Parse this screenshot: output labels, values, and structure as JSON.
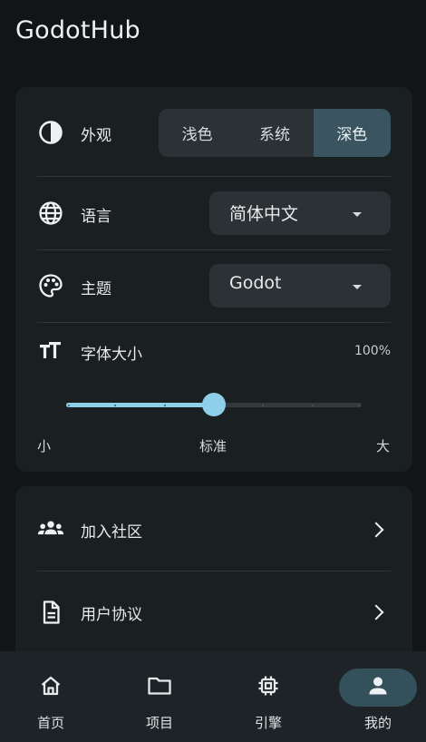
{
  "app": {
    "title": "GodotHub"
  },
  "appearance": {
    "label": "外观",
    "icon": "contrast-icon",
    "options": [
      "浅色",
      "系统",
      "深色"
    ],
    "selected_index": 2
  },
  "language": {
    "label": "语言",
    "icon": "globe-icon",
    "value": "简体中文"
  },
  "theme": {
    "label": "主题",
    "icon": "palette-icon",
    "value": "Godot"
  },
  "font_size": {
    "label": "字体大小",
    "icon": "text-size-icon",
    "value_text": "100%",
    "slider_position": 0.5,
    "steps": 7,
    "scale_labels": {
      "small": "小",
      "standard": "标准",
      "large": "大"
    }
  },
  "links": [
    {
      "label": "加入社区",
      "icon": "community-icon"
    },
    {
      "label": "用户协议",
      "icon": "document-icon"
    }
  ],
  "nav": {
    "items": [
      {
        "label": "首页",
        "icon": "home-icon"
      },
      {
        "label": "项目",
        "icon": "folder-icon"
      },
      {
        "label": "引擎",
        "icon": "chip-icon"
      },
      {
        "label": "我的",
        "icon": "person-icon"
      }
    ],
    "active_index": 3
  },
  "colors": {
    "background": "#111518",
    "card": "#1a1f22",
    "accent": "#8ecfe9",
    "active_segment": "#3a5560"
  }
}
